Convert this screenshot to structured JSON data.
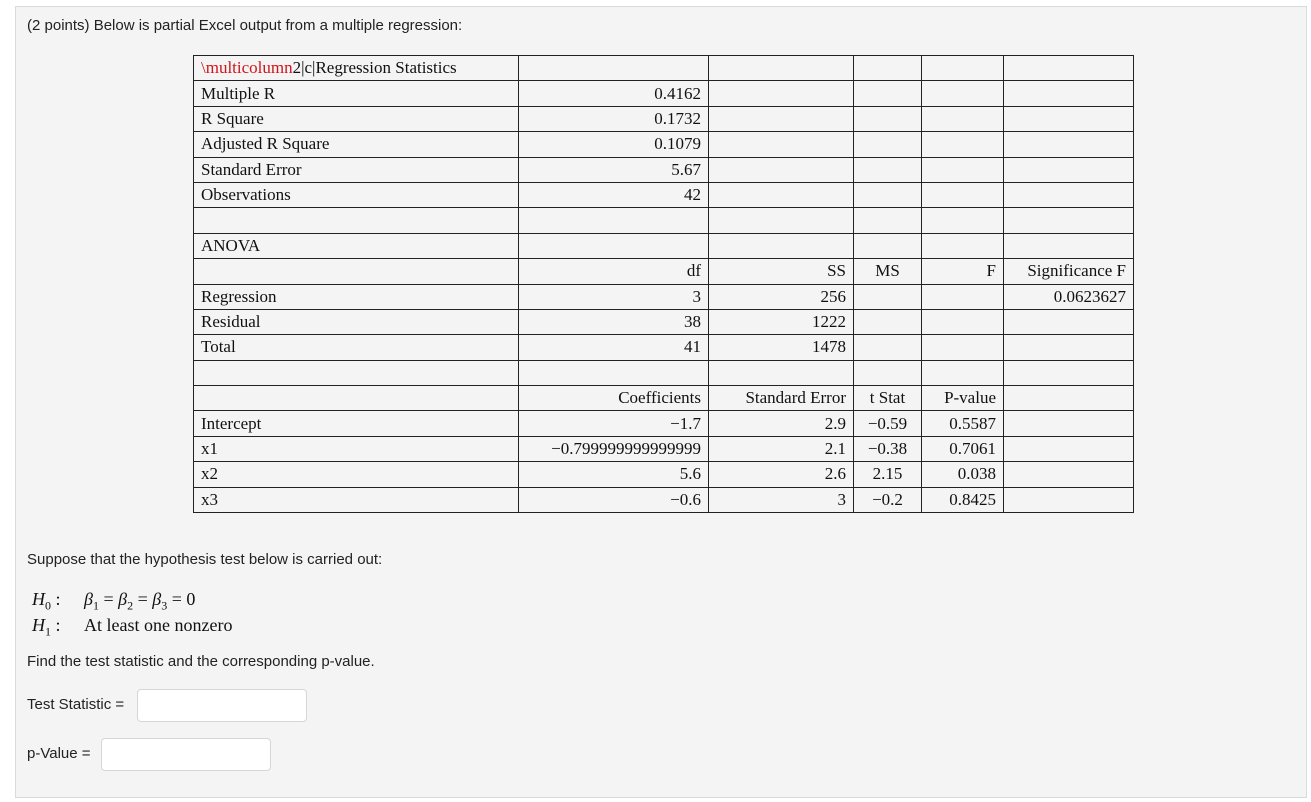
{
  "question": {
    "text": "(2 points) Below is partial Excel output from a multiple regression:"
  },
  "table": {
    "rows": [
      [
        "\\multicolumn2|c|Regression Statistics",
        "",
        "",
        "",
        "",
        ""
      ],
      [
        "Multiple R",
        "0.4162",
        "",
        "",
        "",
        ""
      ],
      [
        "R Square",
        "0.1732",
        "",
        "",
        "",
        ""
      ],
      [
        "Adjusted R Square",
        "0.1079",
        "",
        "",
        "",
        ""
      ],
      [
        "Standard Error",
        "5.67",
        "",
        "",
        "",
        ""
      ],
      [
        "Observations",
        "42",
        "",
        "",
        "",
        ""
      ],
      [
        "",
        "",
        "",
        "",
        "",
        ""
      ],
      [
        "ANOVA",
        "",
        "",
        "",
        "",
        ""
      ],
      [
        "",
        "df",
        "SS",
        "MS",
        "F",
        "Significance F"
      ],
      [
        "Regression",
        "3",
        "256",
        "",
        "",
        "0.0623627"
      ],
      [
        "Residual",
        "38",
        "1222",
        "",
        "",
        ""
      ],
      [
        "Total",
        "41",
        "1478",
        "",
        "",
        ""
      ],
      [
        "",
        "",
        "",
        "",
        "",
        ""
      ],
      [
        "",
        "Coefficients",
        "Standard Error",
        "t Stat",
        "P-value",
        ""
      ],
      [
        "Intercept",
        "−1.7",
        "2.9",
        "−0.59",
        "0.5587",
        ""
      ],
      [
        "x1",
        "−0.799999999999999",
        "2.1",
        "−0.38",
        "0.7061",
        ""
      ],
      [
        "x2",
        "5.6",
        "2.6",
        "2.15",
        "0.038",
        ""
      ],
      [
        "x3",
        "−0.6",
        "3",
        "−0.2",
        "0.8425",
        ""
      ]
    ],
    "header_error": {
      "command": "\\multicolumn",
      "args": "2|c|",
      "title": "Regression Statistics"
    }
  },
  "hypothesis": {
    "intro": "Suppose that the hypothesis test below is carried out:",
    "h0_label": "H",
    "h0_sub": "0",
    "h0_colon": ":",
    "h0_statement": "β1 = β2 = β3 = 0",
    "h1_label": "H",
    "h1_sub": "1",
    "h1_colon": ":",
    "h1_statement": "At least one nonzero"
  },
  "instructions": "Find the test statistic and the corresponding p-value.",
  "answers": {
    "test_statistic_label": "Test Statistic =",
    "test_statistic_value": "",
    "p_value_label": "p-Value =",
    "p_value_value": ""
  }
}
